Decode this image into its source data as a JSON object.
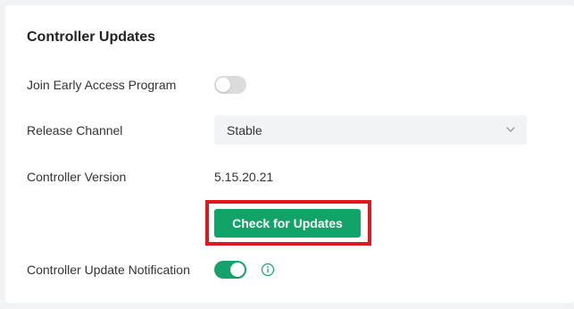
{
  "section": {
    "title": "Controller Updates"
  },
  "early_access": {
    "label": "Join Early Access Program",
    "enabled": false
  },
  "release_channel": {
    "label": "Release Channel",
    "selected": "Stable"
  },
  "controller_version": {
    "label": "Controller Version",
    "value": "5.15.20.21"
  },
  "check_updates": {
    "button_label": "Check for Updates"
  },
  "update_notification": {
    "label": "Controller Update Notification",
    "enabled": true
  },
  "colors": {
    "accent": "#12a369",
    "highlight": "#e0171f",
    "toggle_off": "#dcdcdc"
  },
  "icons": {
    "chevron": "chevron-down-icon",
    "info": "info-icon"
  }
}
